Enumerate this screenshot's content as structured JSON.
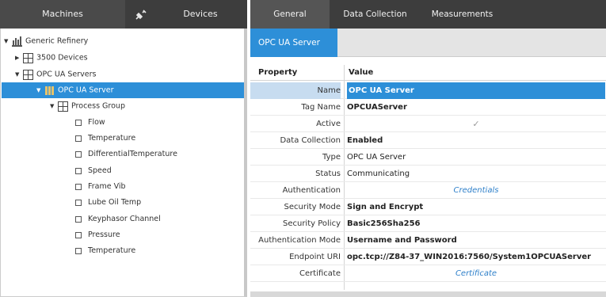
{
  "left_tabs": {
    "machines": "Machines",
    "plug_icon": "plug-icon",
    "devices": "Devices"
  },
  "tree": {
    "root": "Generic Refinery",
    "n3500": "3500 Devices",
    "opc_servers": "OPC UA Servers",
    "opc_server": "OPC UA Server",
    "process_group": "Process Group",
    "points": [
      "Flow",
      "Temperature",
      "DifferentialTemperature",
      "Speed",
      "Frame Vib",
      "Lube Oil Temp",
      "Keyphasor Channel",
      "Pressure",
      "Temperature"
    ]
  },
  "right_tabs": {
    "general": "General",
    "data_collection": "Data Collection",
    "measurements": "Measurements"
  },
  "subtab": "OPC UA Server",
  "props_header": {
    "property": "Property",
    "value": "Value"
  },
  "props": [
    {
      "name": "Name",
      "value": "OPC UA Server"
    },
    {
      "name": "Tag Name",
      "value": "OPCUAServer"
    },
    {
      "name": "Active",
      "value": "✓"
    },
    {
      "name": "Data Collection",
      "value": "Enabled"
    },
    {
      "name": "Type",
      "value": "OPC UA Server"
    },
    {
      "name": "Status",
      "value": "Communicating"
    },
    {
      "name": "Authentication",
      "value": "Credentials"
    },
    {
      "name": "Security Mode",
      "value": "Sign and Encrypt"
    },
    {
      "name": "Security Policy",
      "value": "Basic256Sha256"
    },
    {
      "name": "Authentication Mode",
      "value": "Username and Password"
    },
    {
      "name": "Endpoint URI",
      "value": "opc.tcp://Z84-37_WIN2016:7560/System1OPCUAServer"
    },
    {
      "name": "Certificate",
      "value": "Certificate"
    }
  ],
  "colors": {
    "accent": "#2d8fd8",
    "tab_bar": "#3d3d3d",
    "link": "#2d7fc9"
  }
}
